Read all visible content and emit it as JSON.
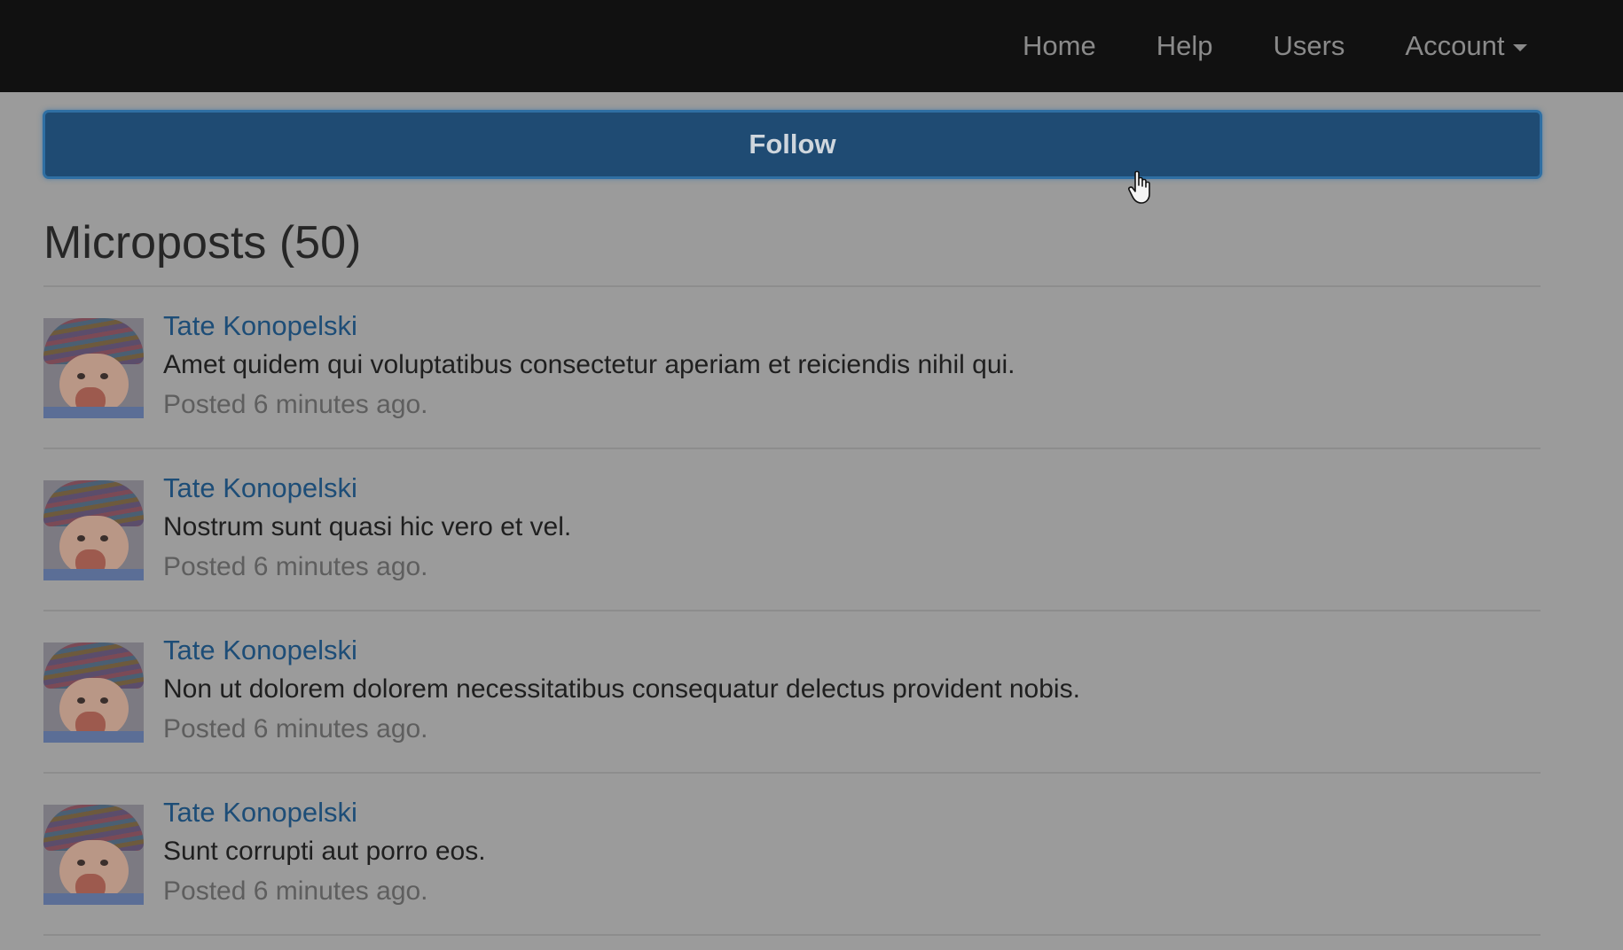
{
  "nav": {
    "links": [
      "Home",
      "Help",
      "Users"
    ],
    "account_label": "Account"
  },
  "follow_button_label": "Follow",
  "microposts_heading": "Microposts (50)",
  "posts": [
    {
      "user": "Tate Konopelski",
      "content": "Amet quidem qui voluptatibus consectetur aperiam et reiciendis nihil qui.",
      "time": "Posted 6 minutes ago."
    },
    {
      "user": "Tate Konopelski",
      "content": "Nostrum sunt quasi hic vero et vel.",
      "time": "Posted 6 minutes ago."
    },
    {
      "user": "Tate Konopelski",
      "content": "Non ut dolorem dolorem necessitatibus consequatur delectus provident nobis.",
      "time": "Posted 6 minutes ago."
    },
    {
      "user": "Tate Konopelski",
      "content": "Sunt corrupti aut porro eos.",
      "time": "Posted 6 minutes ago."
    }
  ],
  "colors": {
    "navbar": "#111111",
    "follow_button": "#1f4b73",
    "link": "#1d4d77",
    "overlay_background": "#9b9b9b"
  },
  "icons": [
    "caret-down-icon",
    "hand-pointer-cursor-icon"
  ]
}
